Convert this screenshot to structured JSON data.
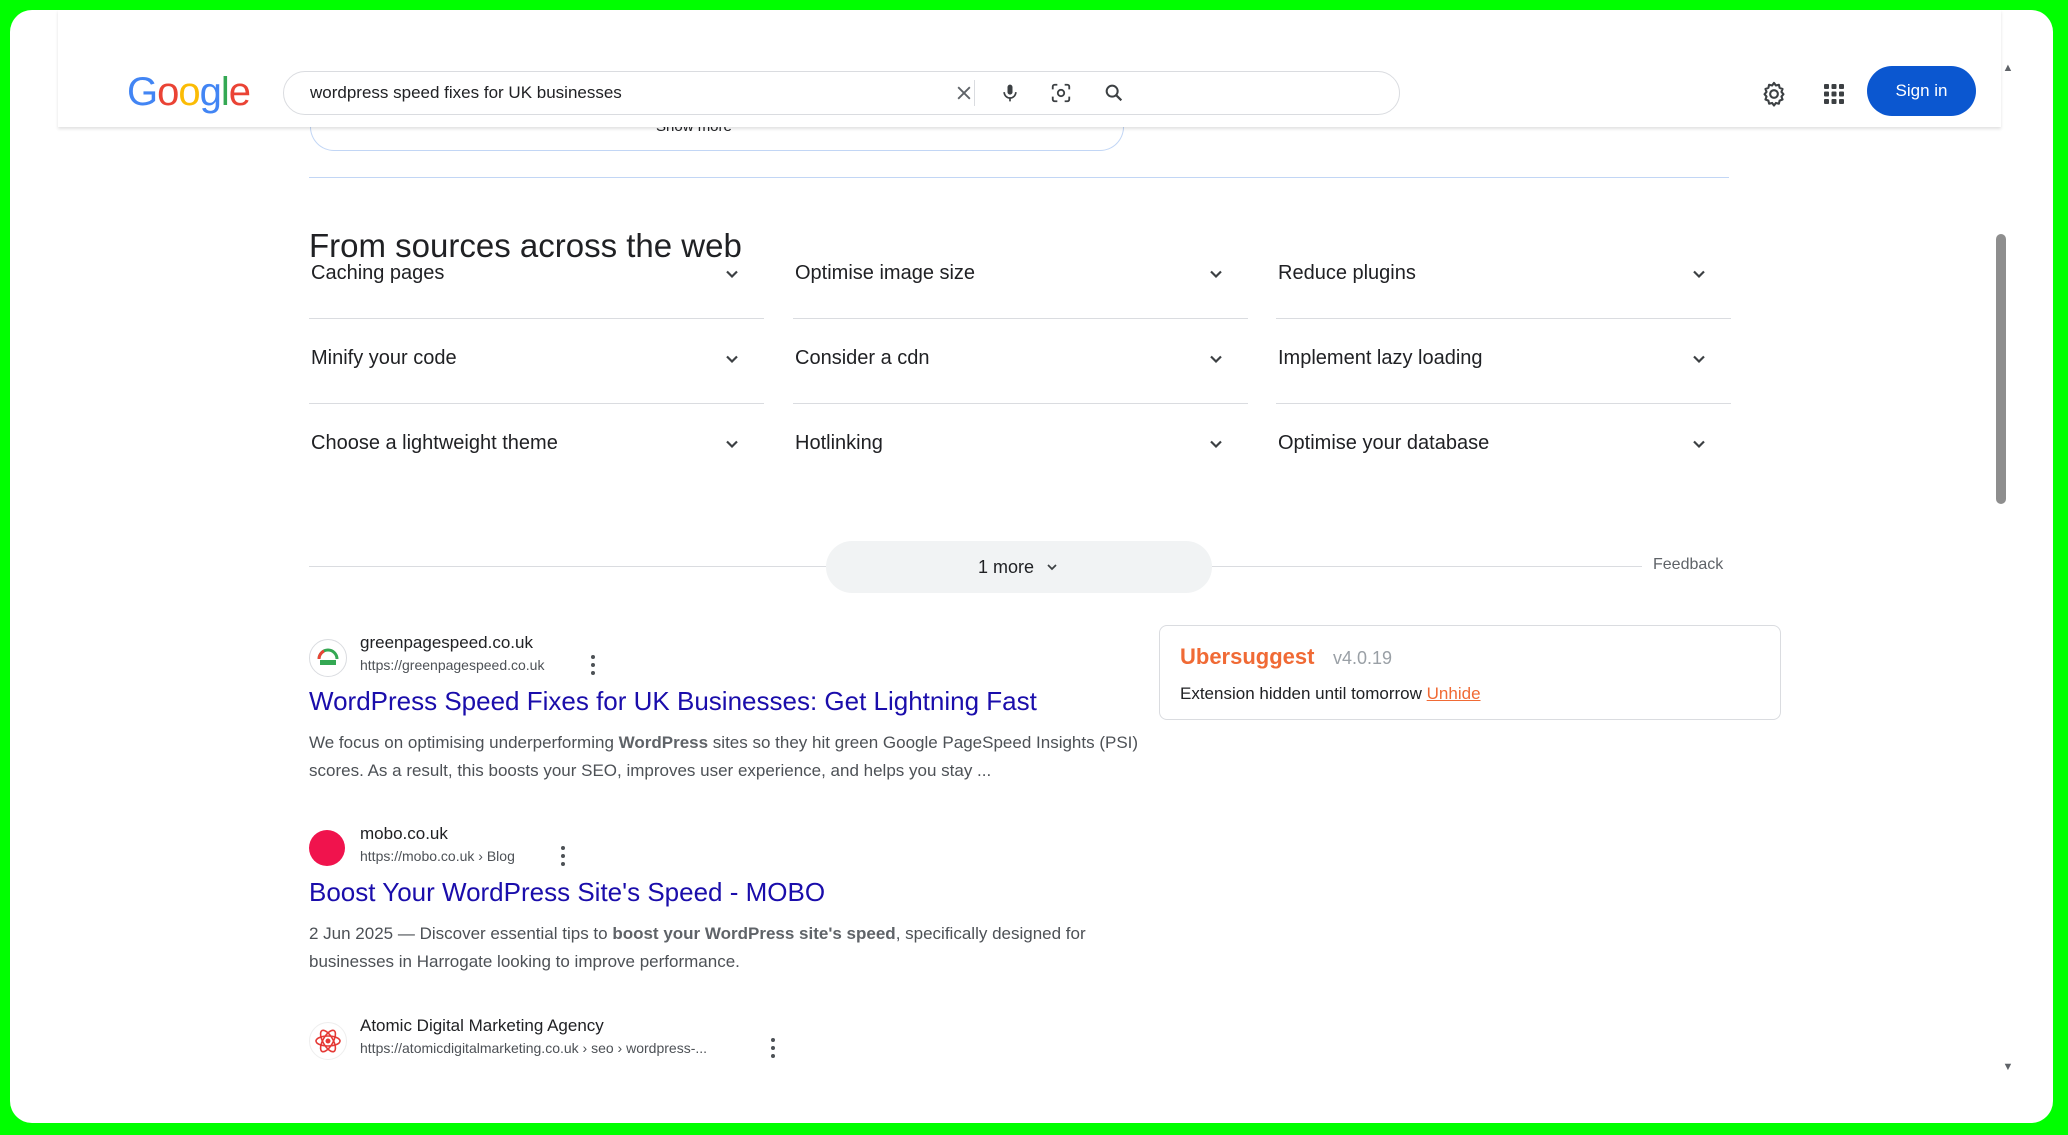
{
  "header": {
    "logo_letters": [
      {
        "ch": "G",
        "color": "#4285f4"
      },
      {
        "ch": "o",
        "color": "#ea4335"
      },
      {
        "ch": "o",
        "color": "#fbbc05"
      },
      {
        "ch": "g",
        "color": "#4285f4"
      },
      {
        "ch": "l",
        "color": "#34a853"
      },
      {
        "ch": "e",
        "color": "#ea4335"
      }
    ],
    "search_query": "wordpress speed fixes for UK businesses",
    "sign_in_label": "Sign in"
  },
  "prev_card": {
    "show_more": "Show more"
  },
  "sources": {
    "title": "From sources across the web",
    "items": [
      "Caching pages",
      "Optimise image size",
      "Reduce plugins",
      "Minify your code",
      "Consider a cdn",
      "Implement lazy loading",
      "Choose a lightweight theme",
      "Hotlinking",
      "Optimise your database"
    ],
    "more_label": "1 more",
    "feedback_label": "Feedback"
  },
  "results": [
    {
      "site_name": "greenpagespeed.co.uk",
      "url": "https://greenpagespeed.co.uk",
      "title": "WordPress Speed Fixes for UK Businesses: Get Lightning Fast",
      "snippet_parts": [
        {
          "t": "We focus on optimising underperforming ",
          "b": false
        },
        {
          "t": "WordPress",
          "b": true
        },
        {
          "t": " sites so they hit green Google PageSpeed Insights (PSI) scores. As a result, this boosts your SEO, improves user experience, and helps you stay ...",
          "b": false
        }
      ]
    },
    {
      "site_name": "mobo.co.uk",
      "url": "https://mobo.co.uk › Blog",
      "title": "Boost Your WordPress Site's Speed - MOBO",
      "snippet_parts": [
        {
          "t": "2 Jun 2025 — Discover essential tips to ",
          "b": false
        },
        {
          "t": "boost your WordPress site's speed",
          "b": true
        },
        {
          "t": ", specifically designed for businesses in Harrogate looking to improve performance.",
          "b": false
        }
      ]
    },
    {
      "site_name": "Atomic Digital Marketing Agency",
      "url": "https://atomicdigitalmarketing.co.uk › seo › wordpress-...",
      "title": "",
      "snippet_parts": []
    }
  ],
  "ubersuggest": {
    "name": "Ubersuggest",
    "version": "v4.0.19",
    "message": "Extension hidden until tomorrow",
    "unhide_label": "Unhide"
  },
  "colors": {
    "accent": "#0b57d0",
    "link": "#1a0dab",
    "uber": "#f06a35"
  }
}
